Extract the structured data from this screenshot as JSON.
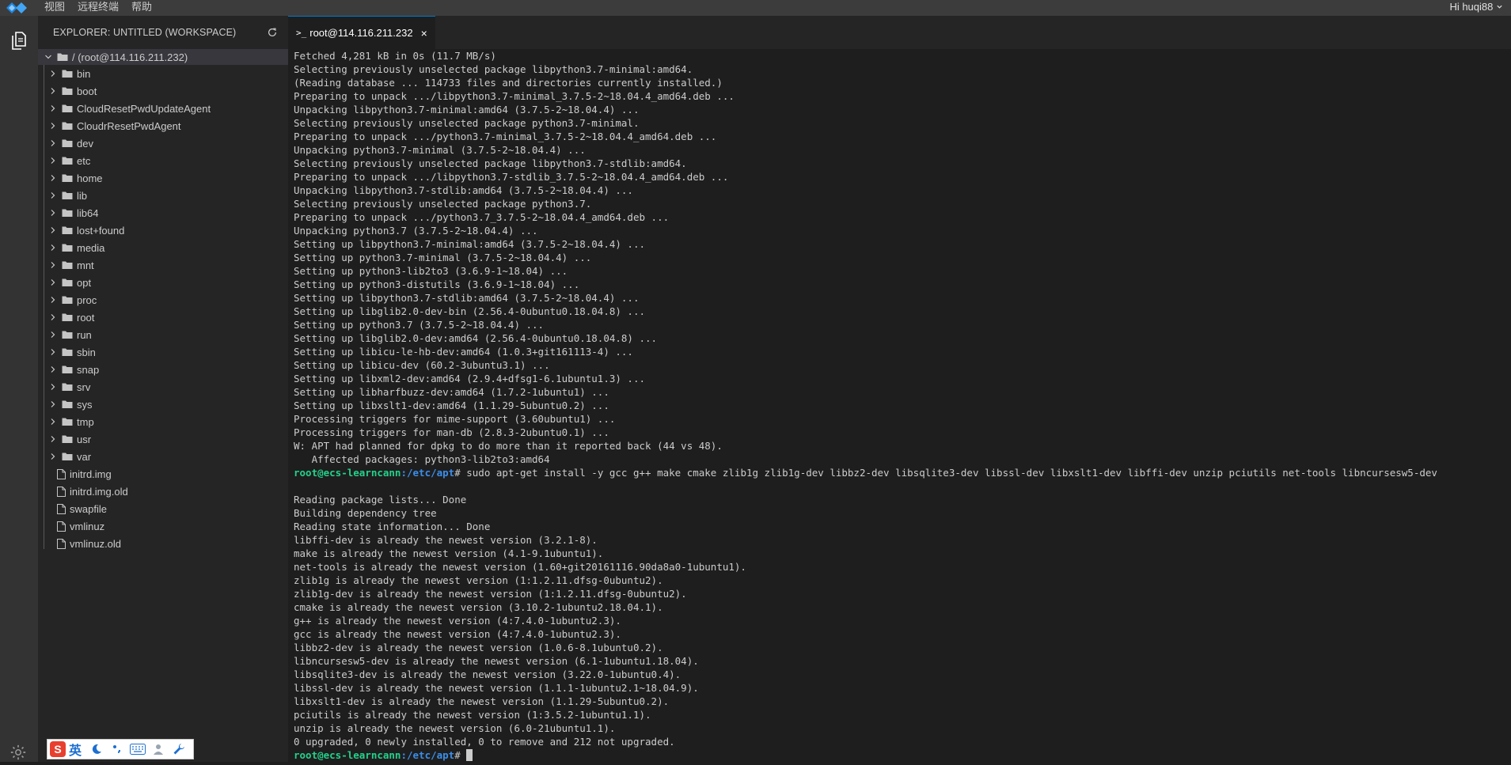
{
  "menubar": {
    "items": [
      "视图",
      "远程终端",
      "帮助"
    ],
    "user": "Hi huqi88"
  },
  "sidebar": {
    "title": "EXPLORER: UNTITLED (WORKSPACE)",
    "root": "/ (root@114.116.211.232)",
    "folders": [
      "bin",
      "boot",
      "CloudResetPwdUpdateAgent",
      "CloudrResetPwdAgent",
      "dev",
      "etc",
      "home",
      "lib",
      "lib64",
      "lost+found",
      "media",
      "mnt",
      "opt",
      "proc",
      "root",
      "run",
      "sbin",
      "snap",
      "srv",
      "sys",
      "tmp",
      "usr",
      "var"
    ],
    "files": [
      "initrd.img",
      "initrd.img.old",
      "swapfile",
      "vmlinuz",
      "vmlinuz.old"
    ]
  },
  "tab": {
    "icon": ">_",
    "label": "root@114.116.211.232",
    "close": "×"
  },
  "terminal": {
    "prompt_user": "root@ecs-learncann",
    "prompt_path": ":/etc/apt",
    "prompt_symbol": "#",
    "lines_before": [
      "Fetched 4,281 kB in 0s (11.7 MB/s)",
      "Selecting previously unselected package libpython3.7-minimal:amd64.",
      "(Reading database ... 114733 files and directories currently installed.)",
      "Preparing to unpack .../libpython3.7-minimal_3.7.5-2~18.04.4_amd64.deb ...",
      "Unpacking libpython3.7-minimal:amd64 (3.7.5-2~18.04.4) ...",
      "Selecting previously unselected package python3.7-minimal.",
      "Preparing to unpack .../python3.7-minimal_3.7.5-2~18.04.4_amd64.deb ...",
      "Unpacking python3.7-minimal (3.7.5-2~18.04.4) ...",
      "Selecting previously unselected package libpython3.7-stdlib:amd64.",
      "Preparing to unpack .../libpython3.7-stdlib_3.7.5-2~18.04.4_amd64.deb ...",
      "Unpacking libpython3.7-stdlib:amd64 (3.7.5-2~18.04.4) ...",
      "Selecting previously unselected package python3.7.",
      "Preparing to unpack .../python3.7_3.7.5-2~18.04.4_amd64.deb ...",
      "Unpacking python3.7 (3.7.5-2~18.04.4) ...",
      "Setting up libpython3.7-minimal:amd64 (3.7.5-2~18.04.4) ...",
      "Setting up python3.7-minimal (3.7.5-2~18.04.4) ...",
      "Setting up python3-lib2to3 (3.6.9-1~18.04) ...",
      "Setting up python3-distutils (3.6.9-1~18.04) ...",
      "Setting up libpython3.7-stdlib:amd64 (3.7.5-2~18.04.4) ...",
      "Setting up libglib2.0-dev-bin (2.56.4-0ubuntu0.18.04.8) ...",
      "Setting up python3.7 (3.7.5-2~18.04.4) ...",
      "Setting up libglib2.0-dev:amd64 (2.56.4-0ubuntu0.18.04.8) ...",
      "Setting up libicu-le-hb-dev:amd64 (1.0.3+git161113-4) ...",
      "Setting up libicu-dev (60.2-3ubuntu3.1) ...",
      "Setting up libxml2-dev:amd64 (2.9.4+dfsg1-6.1ubuntu1.3) ...",
      "Setting up libharfbuzz-dev:amd64 (1.7.2-1ubuntu1) ...",
      "Setting up libxslt1-dev:amd64 (1.1.29-5ubuntu0.2) ...",
      "Processing triggers for mime-support (3.60ubuntu1) ...",
      "Processing triggers for man-db (2.8.3-2ubuntu0.1) ...",
      "W: APT had planned for dpkg to do more than it reported back (44 vs 48).",
      "   Affected packages: python3-lib2to3:amd64"
    ],
    "command": " sudo apt-get install -y gcc g++ make cmake zlib1g zlib1g-dev libbz2-dev libsqlite3-dev libssl-dev libxslt1-dev libffi-dev unzip pciutils net-tools libncursesw5-dev",
    "lines_after": [
      "",
      "Reading package lists... Done",
      "Building dependency tree",
      "Reading state information... Done",
      "libffi-dev is already the newest version (3.2.1-8).",
      "make is already the newest version (4.1-9.1ubuntu1).",
      "net-tools is already the newest version (1.60+git20161116.90da8a0-1ubuntu1).",
      "zlib1g is already the newest version (1:1.2.11.dfsg-0ubuntu2).",
      "zlib1g-dev is already the newest version (1:1.2.11.dfsg-0ubuntu2).",
      "cmake is already the newest version (3.10.2-1ubuntu2.18.04.1).",
      "g++ is already the newest version (4:7.4.0-1ubuntu2.3).",
      "gcc is already the newest version (4:7.4.0-1ubuntu2.3).",
      "libbz2-dev is already the newest version (1.0.6-8.1ubuntu0.2).",
      "libncursesw5-dev is already the newest version (6.1-1ubuntu1.18.04).",
      "libsqlite3-dev is already the newest version (3.22.0-1ubuntu0.4).",
      "libssl-dev is already the newest version (1.1.1-1ubuntu2.1~18.04.9).",
      "libxslt1-dev is already the newest version (1.1.29-5ubuntu0.2).",
      "pciutils is already the newest version (1:3.5.2-1ubuntu1.1).",
      "unzip is already the newest version (6.0-21ubuntu1.1).",
      "0 upgraded, 0 newly installed, 0 to remove and 212 not upgraded."
    ]
  },
  "ime": {
    "logo": "S",
    "lang": "英"
  }
}
